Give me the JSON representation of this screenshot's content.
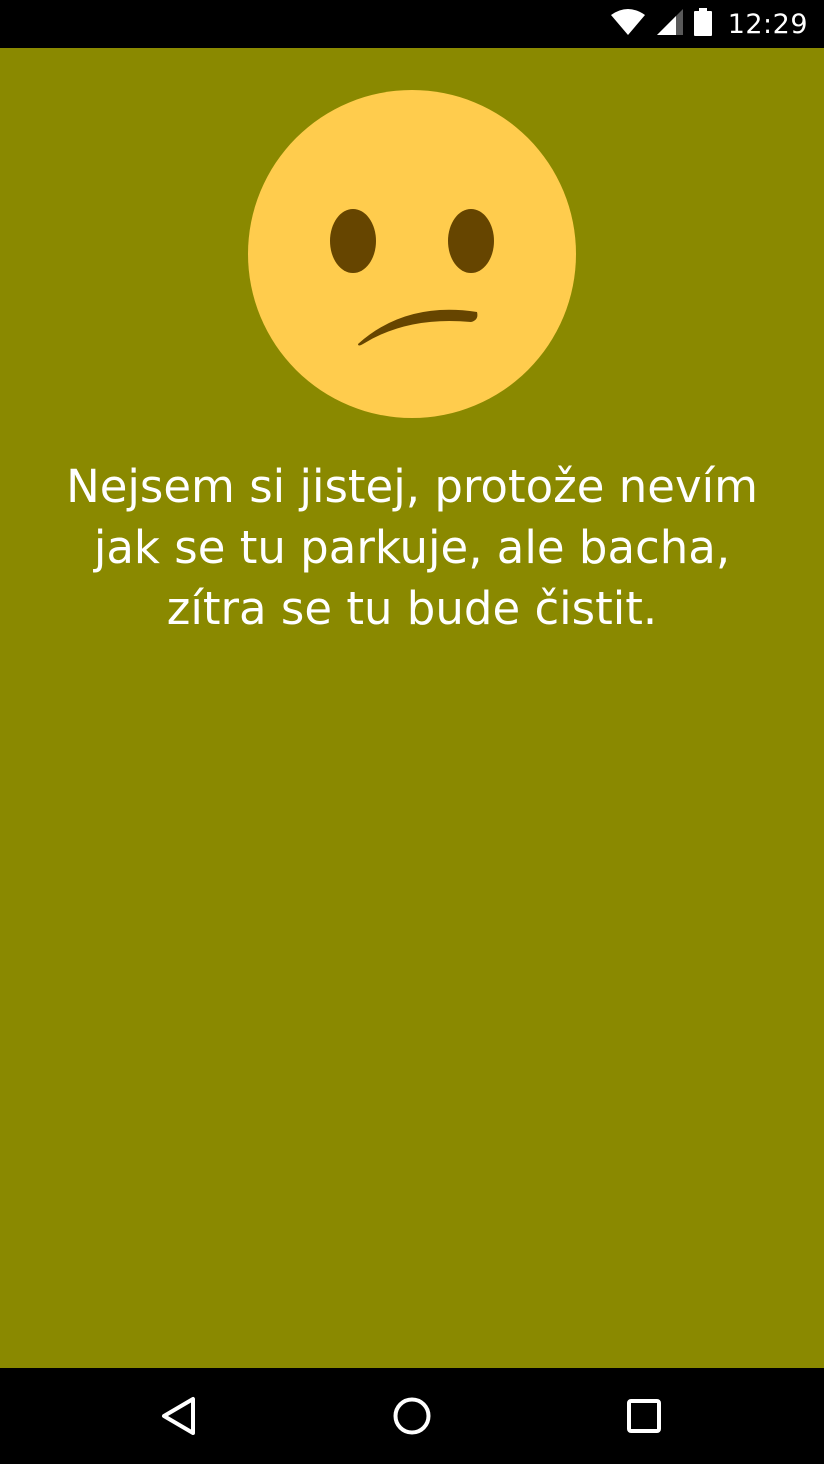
{
  "status_bar": {
    "time": "12:29",
    "icons": [
      "wifi-icon",
      "cellular-signal-icon",
      "battery-icon"
    ]
  },
  "colors": {
    "background": "#8a8900",
    "status_bar": "#000000",
    "nav_bar": "#000000",
    "emoji_face": "#ffcc4d",
    "emoji_features": "#664500",
    "text": "#ffffff"
  },
  "main": {
    "emoji": "confused-face-icon",
    "message": "Nejsem si jistej, protože nevím jak se tu parkuje, ale bacha, zítra se tu bude čistit."
  },
  "nav_bar": {
    "buttons": [
      "back-icon",
      "home-icon",
      "recents-icon"
    ]
  }
}
